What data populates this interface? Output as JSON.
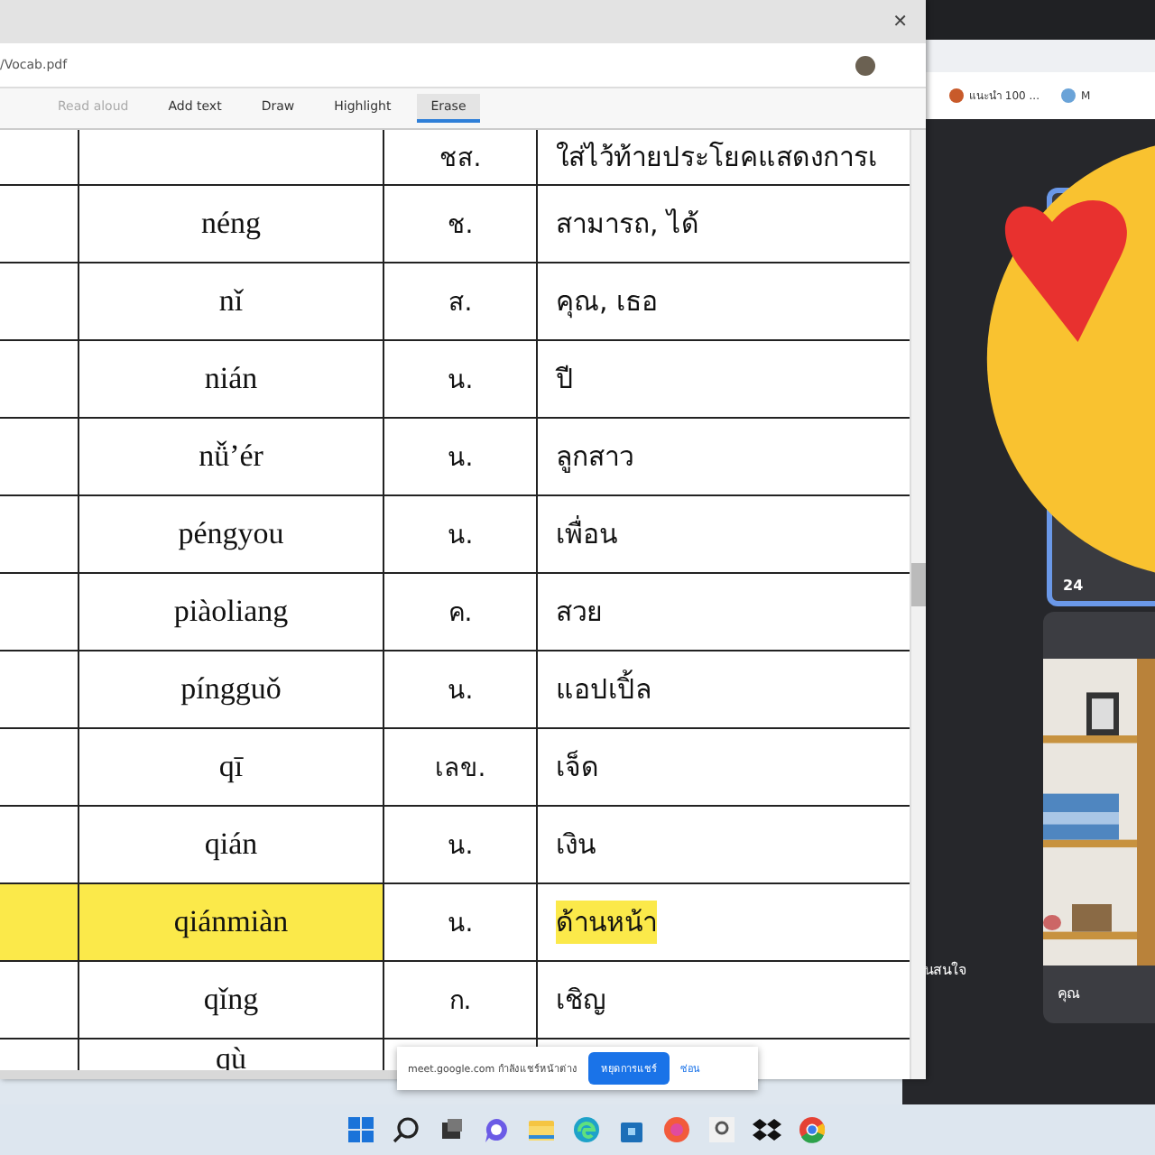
{
  "pdf_window": {
    "close": "✕",
    "address": "/Vocab.pdf",
    "toolbar": [
      {
        "label": "Read aloud",
        "selected": false,
        "disabled": true
      },
      {
        "label": "Add text",
        "selected": false,
        "disabled": false
      },
      {
        "label": "Draw",
        "selected": false,
        "disabled": false
      },
      {
        "label": "Highlight",
        "selected": false,
        "disabled": false
      },
      {
        "label": "Erase",
        "selected": true,
        "disabled": false
      }
    ]
  },
  "table": {
    "rows": [
      {
        "pinyin": "",
        "type": "ชส.",
        "meaning": "ใส่ไว้ท้ายประโยคแสดงการเ",
        "highlighted": false
      },
      {
        "pinyin": "néng",
        "type": "ช.",
        "meaning": "สามารถ, ได้",
        "highlighted": false
      },
      {
        "pinyin": "nǐ",
        "type": "ส.",
        "meaning": "คุณ, เธอ",
        "highlighted": false
      },
      {
        "pinyin": "nián",
        "type": "น.",
        "meaning": "ปี",
        "highlighted": false
      },
      {
        "pinyin": "nǚ’ér",
        "type": "น.",
        "meaning": "ลูกสาว",
        "highlighted": false
      },
      {
        "pinyin": "péngyou",
        "type": "น.",
        "meaning": "เพื่อน",
        "highlighted": false
      },
      {
        "pinyin": "piàoliang",
        "type": "ค.",
        "meaning": "สวย",
        "highlighted": false
      },
      {
        "pinyin": "píngguǒ",
        "type": "น.",
        "meaning": "แอปเปิ้ล",
        "highlighted": false
      },
      {
        "pinyin": "qī",
        "type": "เลข.",
        "meaning": "เจ็ด",
        "highlighted": false
      },
      {
        "pinyin": "qián",
        "type": "น.",
        "meaning": "เงิน",
        "highlighted": false
      },
      {
        "pinyin": "qiánmiàn",
        "type": "น.",
        "meaning": "ด้านหน้า",
        "highlighted": true
      },
      {
        "pinyin": "qǐng",
        "type": "ก.",
        "meaning": "เชิญ",
        "highlighted": false
      },
      {
        "pinyin": "qù",
        "type": "",
        "meaning": "",
        "highlighted": false
      }
    ]
  },
  "share_bar": {
    "message": "meet.google.com กำลังแชร์หน้าต่าง",
    "stop_button": "หยุดการแชร์",
    "hide_link": "ซ่อน"
  },
  "browser": {
    "tabs": [
      "แนะนำ 100 ...",
      "M"
    ]
  },
  "meet": {
    "tile_label": "24",
    "self_label": "คุณ",
    "side_text": "นสนใจ"
  }
}
